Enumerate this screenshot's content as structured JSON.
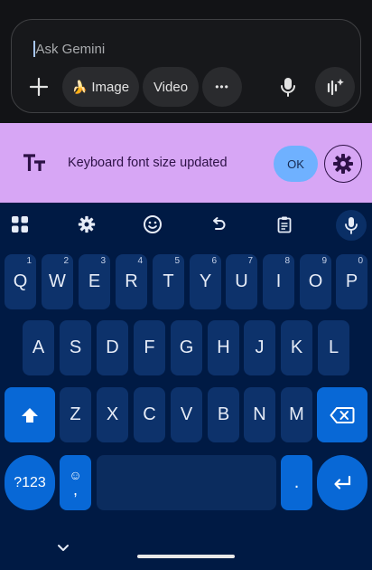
{
  "gemini": {
    "prompt_placeholder": "Ask Gemini",
    "chips": {
      "image": "Image",
      "video": "Video",
      "more": "•••"
    },
    "banana": "🍌"
  },
  "snackbar": {
    "message": "Keyboard font size updated",
    "ok_label": "OK"
  },
  "keyboard": {
    "row1": [
      {
        "k": "Q",
        "n": "1"
      },
      {
        "k": "W",
        "n": "2"
      },
      {
        "k": "E",
        "n": "3"
      },
      {
        "k": "R",
        "n": "4"
      },
      {
        "k": "T",
        "n": "5"
      },
      {
        "k": "Y",
        "n": "6"
      },
      {
        "k": "U",
        "n": "7"
      },
      {
        "k": "I",
        "n": "8"
      },
      {
        "k": "O",
        "n": "9"
      },
      {
        "k": "P",
        "n": "0"
      }
    ],
    "row2": [
      "A",
      "S",
      "D",
      "F",
      "G",
      "H",
      "J",
      "K",
      "L"
    ],
    "row3": [
      "Z",
      "X",
      "C",
      "V",
      "B",
      "N",
      "M"
    ],
    "symbols_label": "?123",
    "comma_label": ",",
    "period_label": ".",
    "emoji_glyph": "☺"
  },
  "colors": {
    "accent": "#0868d6",
    "snackbar": "#d7a6f5",
    "keyboard_bg": "#001a44",
    "key_bg": "#0d326b"
  }
}
